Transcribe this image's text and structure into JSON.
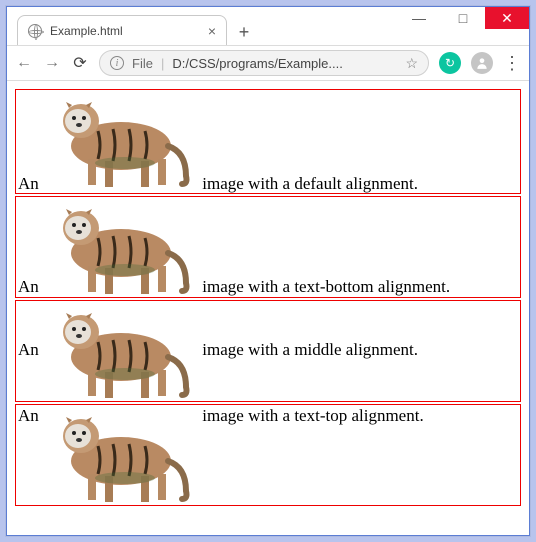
{
  "window": {
    "tab_title": "Example.html",
    "min": "—",
    "max": "□",
    "close": "✕",
    "new_tab": "+"
  },
  "toolbar": {
    "back": "←",
    "forward": "→",
    "reload": "⟳",
    "info": "i",
    "file_label": "File",
    "sep": "|",
    "url": "D:/CSS/programs/Example....",
    "star": "☆",
    "ext_badge": "↻",
    "menu": "⋮"
  },
  "rows": [
    {
      "prefix": "An",
      "suffix": "image with a default alignment.",
      "valign": "baseline"
    },
    {
      "prefix": "An",
      "suffix": "image with a text-bottom alignment.",
      "valign": "text-bottom"
    },
    {
      "prefix": "An",
      "suffix": "image with a middle alignment.",
      "valign": "middle"
    },
    {
      "prefix": "An",
      "suffix": "image with a text-top alignment.",
      "valign": "text-top"
    }
  ],
  "tiger_svg": "<svg viewBox='0 0 155 98' xmlns='http://www.w3.org/2000/svg'><ellipse cx='78' cy='55' rx='50' ry='24' fill='#b98a63'/><ellipse cx='38' cy='30' rx='18' ry='17' fill='#c49a74'/><ellipse cx='35' cy='30' rx='13' ry='12' fill='#e7e1d8'/><circle cx='31' cy='27' r='2' fill='#222'/><circle cx='41' cy='27' r='2' fill='#222'/><ellipse cx='36' cy='34' rx='3' ry='2' fill='#333'/><path d='M26 17 l-3 -6 l6 3z' fill='#a77c55'/><path d='M46 17 l3 -6 l-6 3z' fill='#a77c55'/><rect x='45' y='68' width='8' height='26' fill='#b68a63'/><rect x='62' y='70' width='8' height='26' fill='#a77c55'/><rect x='98' y='70' width='8' height='26' fill='#a77c55'/><rect x='115' y='68' width='8' height='26' fill='#b68a63'/><path d='M125 55 q18 6 18 30 q2 8 -4 8' stroke='#8a6b4a' stroke-width='6' fill='none' stroke-linecap='round'/><path d='M55 40 q4 14 0 28' stroke='#3a2a1a' stroke-width='3' fill='none'/><path d='M70 38 q4 16 0 32' stroke='#3a2a1a' stroke-width='3' fill='none'/><path d='M86 38 q4 16 0 32' stroke='#3a2a1a' stroke-width='3' fill='none'/><path d='M102 40 q4 14 0 28' stroke='#3a2a1a' stroke-width='3' fill='none'/><ellipse cx='82' cy='72' rx='30' ry='6' fill='#4a6b3a' opacity='0.35'/></svg>"
}
